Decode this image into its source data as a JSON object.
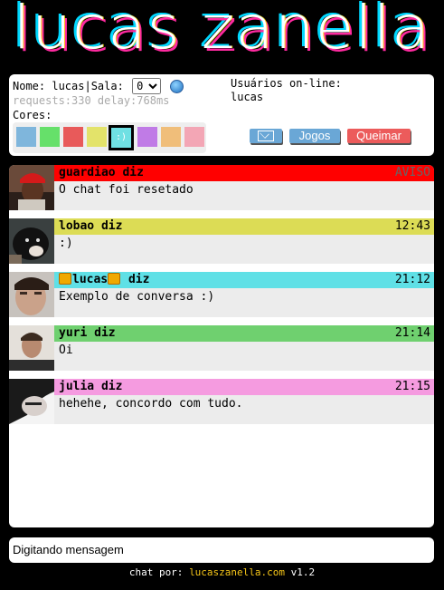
{
  "logo": {
    "text": "lucas zanella"
  },
  "panel": {
    "name_label": "Nome: lucas|Sala:",
    "room_value": "0",
    "stats": "requests:330 delay:768ms",
    "cores_label": "Cores:",
    "selected_swatch_text": ":)",
    "swatches": [
      "#7fb6dc",
      "#66e06a",
      "#e85a5a",
      "#e3e36a",
      "#6fe0e3",
      "#c07be6",
      "#f0be7a",
      "#f3a6b5"
    ],
    "online_title": "Usuários on-line:",
    "online_users": [
      "lucas"
    ],
    "buttons": {
      "jogos": "Jogos",
      "queimar": "Queimar"
    }
  },
  "messages": [
    {
      "author": "guardiao diz",
      "time": "AVISO",
      "text": "O chat foi resetado",
      "color": "#ff0000",
      "text_color": "#000",
      "time_color": "#777"
    },
    {
      "author": "lobao diz",
      "time": "12:43",
      "text": ":)",
      "color": "#dcdc55"
    },
    {
      "author": "lucas",
      "author_suffix": " diz",
      "time": "21:12",
      "text": "Exemplo de conversa :)",
      "color": "#5fe0e6"
    },
    {
      "author": "yuri diz",
      "time": "21:14",
      "text": "Oi",
      "color": "#6fd06f"
    },
    {
      "author": "julia diz",
      "time": "21:15",
      "text": "hehehe, concordo com tudo.",
      "color": "#f59be0"
    }
  ],
  "input": {
    "placeholder": "Digitando mensagem"
  },
  "footer": {
    "prefix": "chat por: ",
    "link": "lucaszanella.com",
    "version": " v1.2"
  }
}
